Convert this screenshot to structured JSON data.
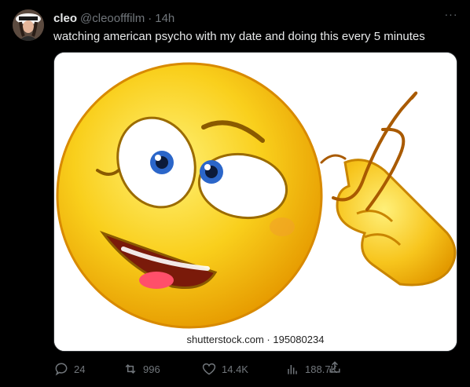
{
  "author": {
    "name": "cleo",
    "handle": "@cleoofffilm",
    "separator": "·",
    "time": "14h"
  },
  "more_label": "···",
  "tweet_text": "watching american psycho with my date and doing this every 5 minutes",
  "media": {
    "watermark": "shutterstock.com · 195080234"
  },
  "actions": {
    "replies": "24",
    "reposts": "996",
    "likes": "14.4K",
    "views": "188.7K"
  },
  "icons": {
    "reply": "reply-bubble-icon",
    "repost": "repost-icon",
    "like": "heart-icon",
    "views": "analytics-icon",
    "share": "share-icon",
    "more": "more-dots-icon"
  },
  "colors": {
    "background": "#000000",
    "text": "#e7e9ea",
    "muted": "#71767b",
    "emoji_yellow": "#f5c21b"
  }
}
